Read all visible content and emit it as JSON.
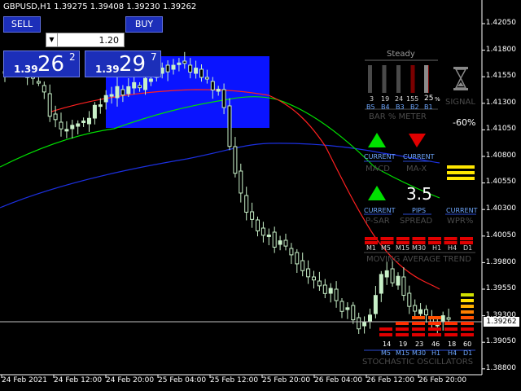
{
  "header": {
    "symbol_line": "GBPUSD,H1  1.39275 1.39408 1.39230 1.39262"
  },
  "trade_panel": {
    "sell_label": "SELL",
    "buy_label": "BUY",
    "lot_value": "1.20",
    "sell_price": {
      "prefix": "1.39",
      "big": "26",
      "super": "2"
    },
    "buy_price": {
      "prefix": "1.39",
      "big": "29",
      "super": "7"
    }
  },
  "y_axis": [
    "1.42050",
    "1.41800",
    "1.41550",
    "1.41300",
    "1.41050",
    "1.40800",
    "1.40550",
    "1.40300",
    "1.40050",
    "1.39800",
    "1.39550",
    "1.39300",
    "1.39050",
    "1.38800"
  ],
  "current_price": "1.39262",
  "x_axis": [
    "24 Feb 2021",
    "24 Feb 12:00",
    "24 Feb 20:00",
    "25 Feb 04:00",
    "25 Feb 12:00",
    "25 Feb 20:00",
    "26 Feb 04:00",
    "26 Feb 12:00",
    "26 Feb 20:00"
  ],
  "dashboard": {
    "steady_label": "Steady",
    "bar_values": [
      "3",
      "19",
      "24",
      "155"
    ],
    "bar_pct": "25",
    "bar_pct_sym": "%",
    "bar_codes": [
      "B5",
      "B4",
      "B3",
      "B2",
      "B1"
    ],
    "bar_meter_label": "BAR % METER",
    "signal_label": "SIGNAL",
    "signal_value": "-60%",
    "macd": {
      "sub": "CURRENT",
      "label": "MACD"
    },
    "max": {
      "sub": "CURRENT",
      "label": "MA-X"
    },
    "psar": {
      "sub": "CURRENT",
      "label": "P-SAR"
    },
    "spread": {
      "value": "3.5",
      "sub": "PIPS",
      "label": "SPREAD"
    },
    "wpr": {
      "sub": "CURRENT",
      "label": "WPR%"
    },
    "ma_trend": {
      "timeframes": [
        "M1",
        "M5",
        "M15",
        "M30",
        "H1",
        "H4",
        "D1"
      ],
      "label": "MOVING AVERAGE TREND"
    },
    "stoch": {
      "values": [
        "14",
        "19",
        "23",
        "46",
        "18",
        "60"
      ],
      "timeframes": [
        "M5",
        "M15",
        "M30",
        "H1",
        "H4",
        "D1"
      ],
      "label": "STOCHASTIC OSCILLATORS"
    }
  },
  "colors": {
    "bull": "#c8f0c8",
    "bear": "#f0f0f0",
    "ma_red": "#ff2020",
    "ma_green": "#00e000",
    "ma_blue": "#1c30e0",
    "rect": "#0a14ff",
    "button": "#1c2fb9"
  }
}
